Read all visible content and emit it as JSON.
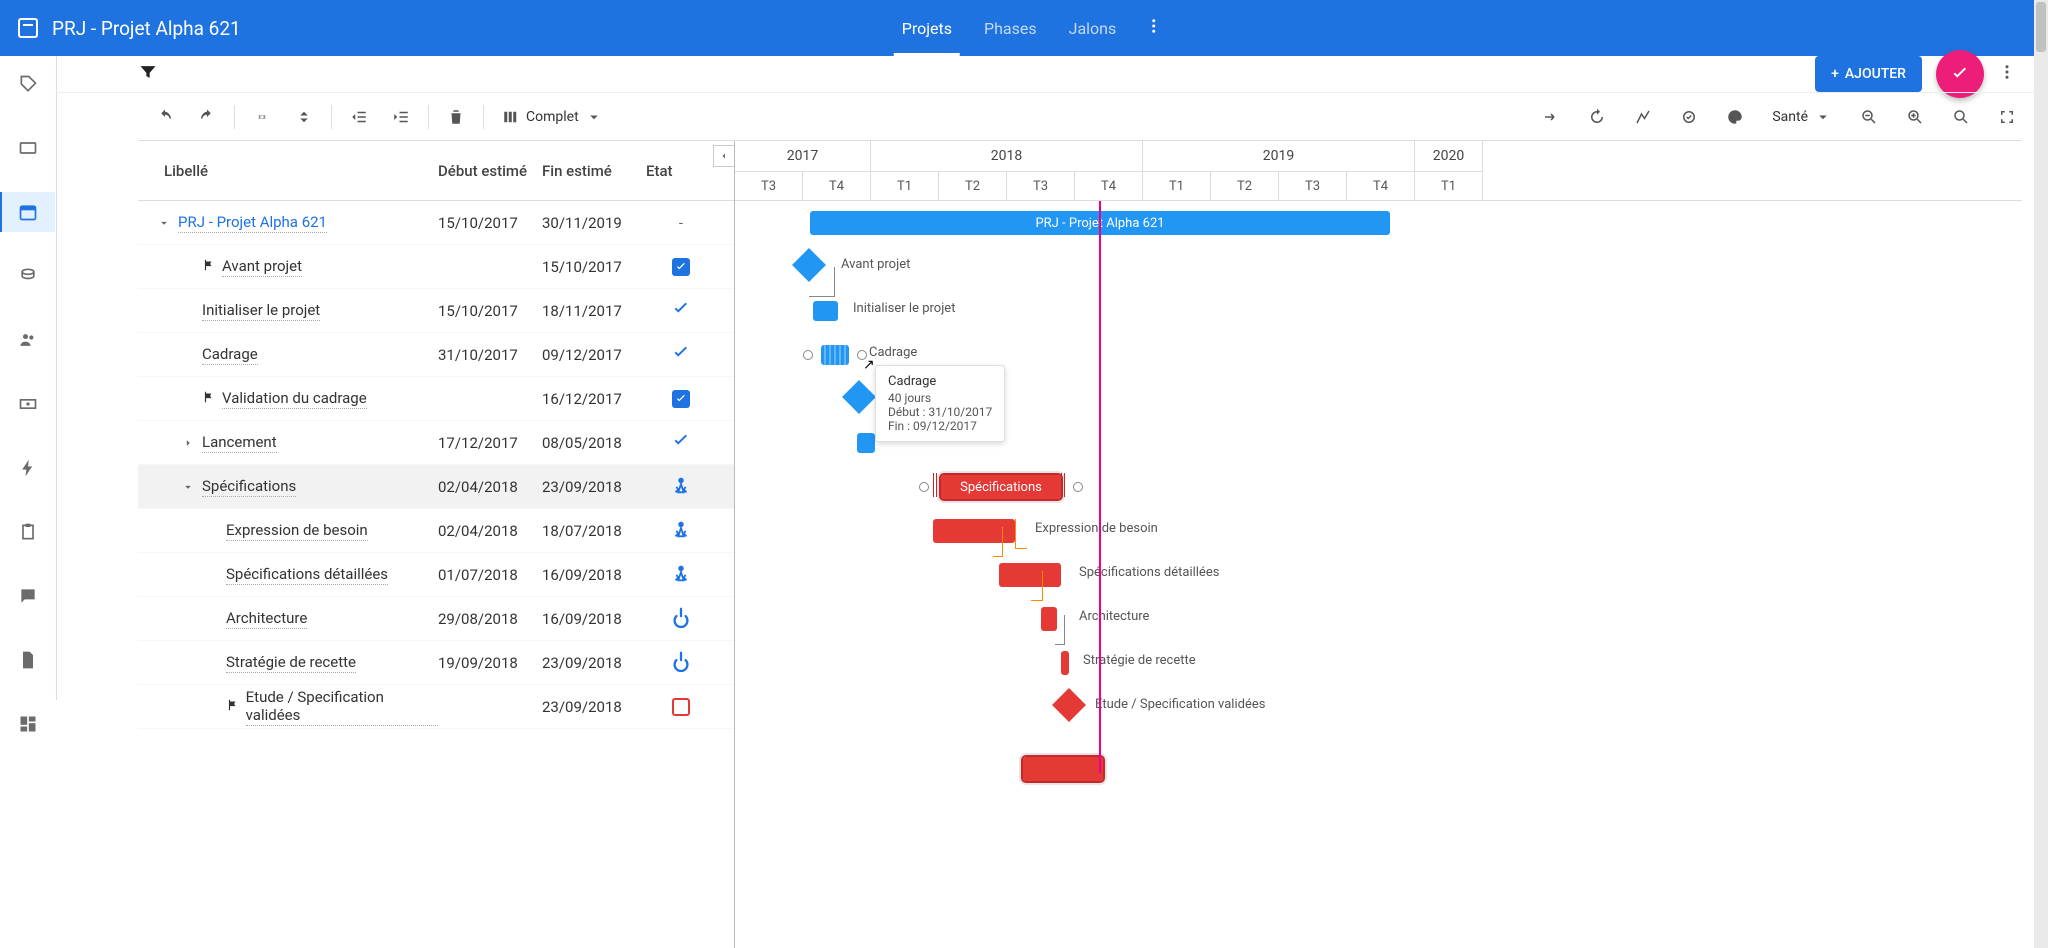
{
  "header": {
    "title": "PRJ - Projet Alpha 621",
    "tabs": [
      {
        "label": "Projets",
        "active": true
      },
      {
        "label": "Phases",
        "active": false
      },
      {
        "label": "Jalons",
        "active": false
      }
    ]
  },
  "subtoolbar": {
    "add_label": "AJOUTER"
  },
  "gantt_toolbar": {
    "view_mode": "Complet",
    "color_by": "Santé"
  },
  "columns": {
    "name": "Libellé",
    "start": "Début estimé",
    "end": "Fin estimé",
    "state": "Etat"
  },
  "rows": [
    {
      "id": "prj",
      "indent": 0,
      "caret": "down",
      "type": "link",
      "flag": false,
      "name": "PRJ - Projet Alpha 621",
      "start": "15/10/2017",
      "end": "30/11/2019",
      "state": "dash"
    },
    {
      "id": "avant",
      "indent": 1,
      "caret": "",
      "type": "flag",
      "flag": true,
      "name": "Avant projet",
      "start": "",
      "end": "15/10/2017",
      "state": "chkbox"
    },
    {
      "id": "init",
      "indent": 1,
      "caret": "",
      "type": "",
      "flag": false,
      "name": "Initialiser le projet",
      "start": "15/10/2017",
      "end": "18/11/2017",
      "state": "tick"
    },
    {
      "id": "cadrage",
      "indent": 1,
      "caret": "",
      "type": "",
      "flag": false,
      "name": "Cadrage",
      "start": "31/10/2017",
      "end": "09/12/2017",
      "state": "tick"
    },
    {
      "id": "valcad",
      "indent": 1,
      "caret": "",
      "type": "flag",
      "flag": true,
      "name": "Validation du cadrage",
      "start": "",
      "end": "16/12/2017",
      "state": "chkbox"
    },
    {
      "id": "lance",
      "indent": 1,
      "caret": "right",
      "type": "",
      "flag": false,
      "name": "Lancement",
      "start": "17/12/2017",
      "end": "08/05/2018",
      "state": "tick"
    },
    {
      "id": "spec",
      "indent": 1,
      "caret": "down",
      "type": "",
      "flag": false,
      "name": "Spécifications",
      "start": "02/04/2018",
      "end": "23/09/2018",
      "state": "person",
      "selected": true
    },
    {
      "id": "expr",
      "indent": 2,
      "caret": "",
      "type": "",
      "flag": false,
      "name": "Expression de besoin",
      "start": "02/04/2018",
      "end": "18/07/2018",
      "state": "person"
    },
    {
      "id": "specdet",
      "indent": 2,
      "caret": "",
      "type": "",
      "flag": false,
      "name": "Spécifications détaillées",
      "start": "01/07/2018",
      "end": "16/09/2018",
      "state": "person"
    },
    {
      "id": "arch",
      "indent": 2,
      "caret": "",
      "type": "",
      "flag": false,
      "name": "Architecture",
      "start": "29/08/2018",
      "end": "16/09/2018",
      "state": "power"
    },
    {
      "id": "strat",
      "indent": 2,
      "caret": "",
      "type": "",
      "flag": false,
      "name": "Stratégie de recette",
      "start": "19/09/2018",
      "end": "23/09/2018",
      "state": "power"
    },
    {
      "id": "etude",
      "indent": 2,
      "caret": "",
      "type": "flag",
      "flag": true,
      "name": "Etude / Specification validées",
      "start": "",
      "end": "23/09/2018",
      "state": "chkout"
    }
  ],
  "timeline": {
    "years": [
      {
        "label": "2017",
        "span": 2
      },
      {
        "label": "2018",
        "span": 4
      },
      {
        "label": "2019",
        "span": 4
      },
      {
        "label": "2020",
        "span": 1
      }
    ],
    "quarters": [
      "T3",
      "T4",
      "T1",
      "T2",
      "T3",
      "T4",
      "T1",
      "T2",
      "T3",
      "T4",
      "T1"
    ],
    "qwidth": 68
  },
  "tooltip": {
    "title": "Cadrage",
    "duration": "40 jours",
    "start": "Début : 31/10/2017",
    "end": "Fin : 09/12/2017"
  },
  "bar_labels": {
    "prj": "PRJ - Projet Alpha 621",
    "avant": "Avant projet",
    "init": "Initialiser le projet",
    "cadrage": "Cadrage",
    "valcad": "Validation du cadrage",
    "spec": "Spécifications",
    "expr": "Expression de besoin",
    "specdet": "Spécifications détaillées",
    "arch": "Architecture",
    "strat": "Stratégie de recette",
    "etude": "Etude / Specification validées"
  }
}
